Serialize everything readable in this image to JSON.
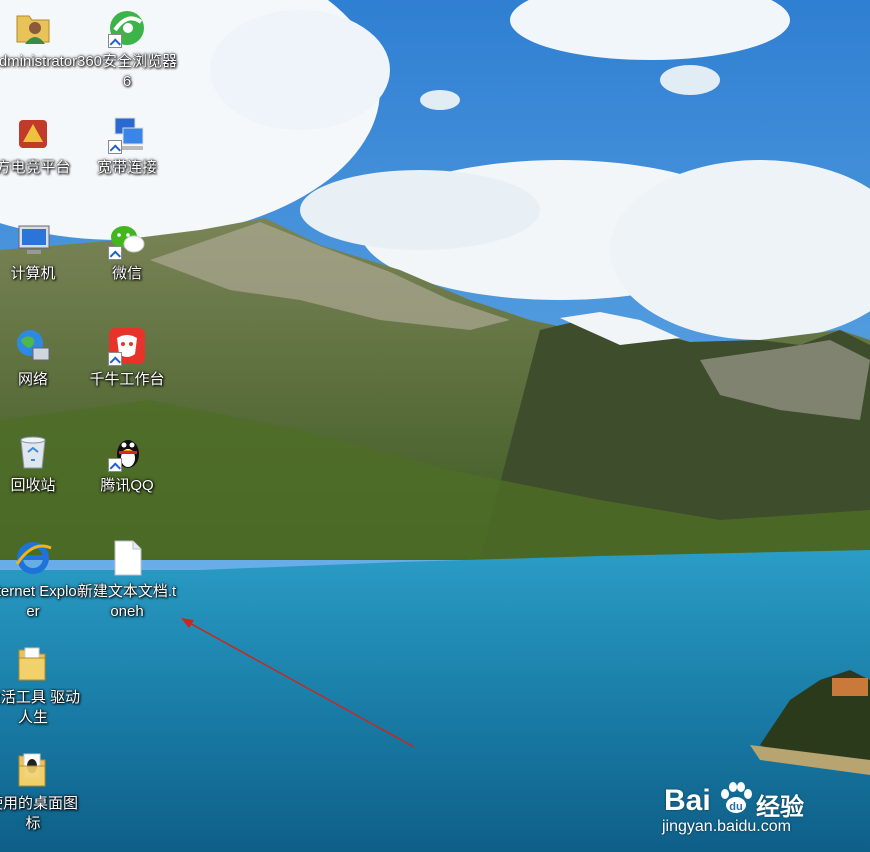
{
  "desktop": {
    "icons": [
      {
        "label": "Administrator",
        "icon": "user-folder-icon"
      },
      {
        "label": "360安全浏览器6",
        "icon": "browser-360-icon"
      },
      {
        "label": "方电竞平台",
        "icon": "esports-platform-icon"
      },
      {
        "label": "宽带连接",
        "icon": "network-connection-icon"
      },
      {
        "label": "计算机",
        "icon": "computer-icon"
      },
      {
        "label": "微信",
        "icon": "wechat-icon"
      },
      {
        "label": "网络",
        "icon": "network-globe-icon"
      },
      {
        "label": "千牛工作台",
        "icon": "qianniu-icon"
      },
      {
        "label": "回收站",
        "icon": "recycle-bin-icon"
      },
      {
        "label": "腾讯QQ",
        "icon": "qq-penguin-icon"
      },
      {
        "label": "Internet Explorer",
        "icon": "internet-explorer-icon"
      },
      {
        "label": "新建文本文档.toneh",
        "icon": "blank-file-icon"
      },
      {
        "label": "激活工具 驱动人生",
        "icon": "folder-icon"
      },
      {
        "label": "使用的桌面图标",
        "icon": "folder-icon"
      }
    ]
  },
  "watermark": {
    "brand": "Bai",
    "brand_suffix": "经验",
    "url": "jingyan.baidu.com"
  },
  "colors": {
    "sky": "#3f8fd8",
    "lake": "#1d87b4",
    "mountain": "#5b6a3a",
    "arrow": "#c8281e"
  }
}
